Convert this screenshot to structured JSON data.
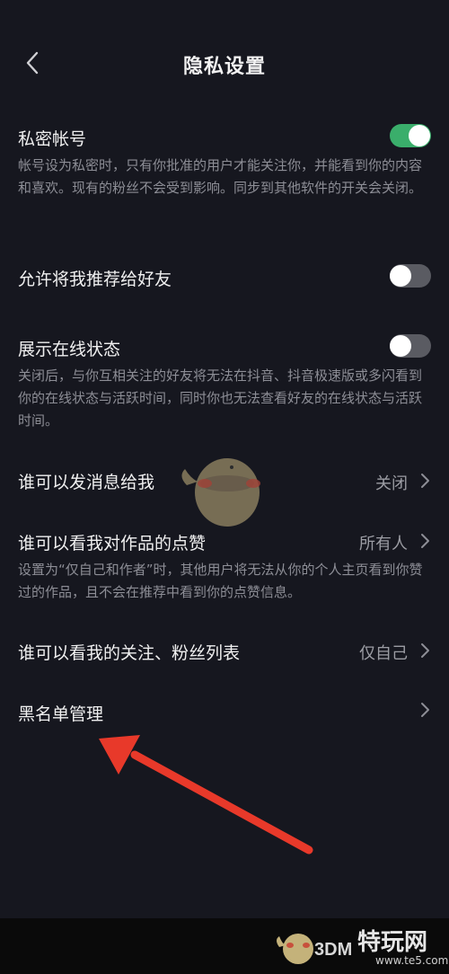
{
  "header": {
    "title": "隐私设置"
  },
  "settings": {
    "private_account": {
      "label": "私密帐号",
      "description": "帐号设为私密时，只有你批准的用户才能关注你，并能看到你的内容和喜欢。现有的粉丝不会受到影响。同步到其他软件的开关会关闭。",
      "enabled": true
    },
    "recommend_to_friends": {
      "label": "允许将我推荐给好友",
      "enabled": false
    },
    "online_status": {
      "label": "展示在线状态",
      "description": "关闭后，与你互相关注的好友将无法在抖音、抖音极速版或多闪看到你的在线状态与活跃时间，同时你也无法查看好友的在线状态与活跃时间。",
      "enabled": false
    },
    "who_can_message": {
      "label": "谁可以发消息给我",
      "value": "关闭"
    },
    "who_can_see_likes": {
      "label": "谁可以看我对作品的点赞",
      "value": "所有人",
      "description": "设置为“仅自己和作者”时，其他用户将无法从你的个人主页看到你赞过的作品，且不会在推荐中看到你的点赞信息。"
    },
    "who_can_see_follow_list": {
      "label": "谁可以看我的关注、粉丝列表",
      "value": "仅自己"
    },
    "blacklist": {
      "label": "黑名单管理"
    }
  },
  "watermark": {
    "brand": "特玩网",
    "site": "3DM",
    "url": "www.te5.com"
  },
  "colors": {
    "background": "#16171f",
    "toggle_on": "#3aae6b",
    "toggle_off": "#5a5b62",
    "arrow": "#e8392a"
  }
}
